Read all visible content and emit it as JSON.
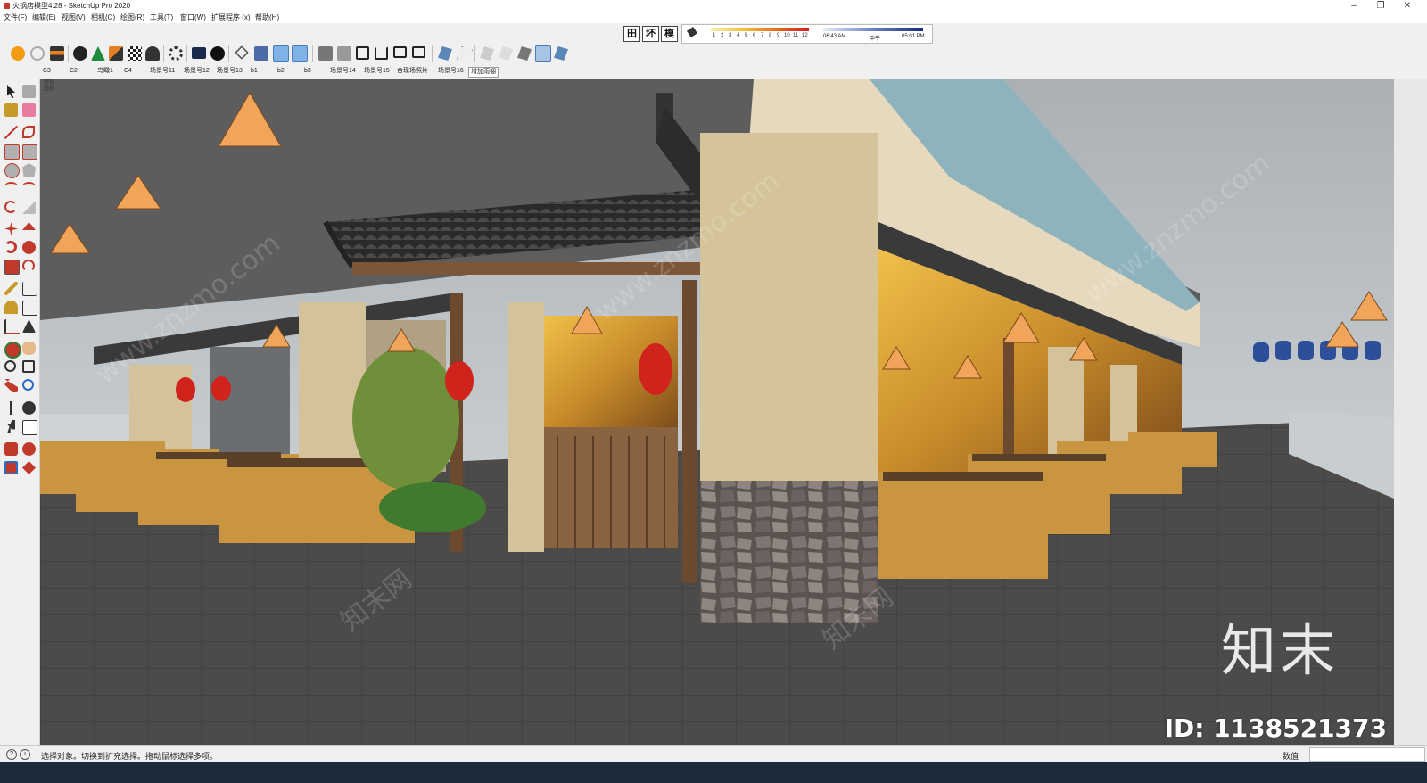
{
  "window": {
    "title": "火锅店模型4.28 - SketchUp Pro 2020",
    "minimize": "–",
    "maximize": "❐",
    "close": "✕"
  },
  "menu": [
    "文件(F)",
    "编辑(E)",
    "视图(V)",
    "相机(C)",
    "绘图(R)",
    "工具(T)",
    "窗口(W)",
    "扩展程序 (x)",
    "帮助(H)"
  ],
  "view_buttons": [
    "田",
    "坏",
    "模"
  ],
  "shadow": {
    "scale": [
      "1",
      "2",
      "3",
      "4",
      "5",
      "6",
      "7",
      "8",
      "9",
      "10",
      "11",
      "12"
    ],
    "time_start": "06:43 AM",
    "time_mid": "中午",
    "time_end": "05:01 PM"
  },
  "scenes": [
    "C3",
    "C2",
    "鸟瞰1",
    "C4",
    "场景号11",
    "场景号12",
    "场景号13",
    "b1",
    "b2",
    "b3",
    "场景号14",
    "场景号15",
    "合现场照片",
    "场景号16",
    "增加雨棚"
  ],
  "active_scene": "增加雨棚",
  "viewport": {
    "corner_label": [
      "俯视",
      "透视"
    ],
    "watermark_logo": "知末",
    "watermark_id": "ID: 1138521373",
    "watermark_site": "www.znzmo.com",
    "watermark_cn": "知末网"
  },
  "status": {
    "text": "选择对象。切换到扩充选择。拖动鼠标选择多项。",
    "measure_label": "数值",
    "measure_value": ""
  },
  "colors": {
    "sky": "#c9cfd3",
    "floor": "#4e4c4b",
    "ceiling": "#5d5d5d",
    "wall": "#d5c49a",
    "wood": "#7d5637",
    "lantern": "#d0231c",
    "roof_tile": "#2c2c2c"
  },
  "icons": {
    "toolbar": [
      "sketchup-logo-icon",
      "refresh-icon",
      "layers-icon",
      "add-circle-icon",
      "tree-icon",
      "terrain-icon",
      "checker-icon",
      "cloud-icon",
      "gear-icon",
      "mail-icon",
      "info-icon",
      "move-icon",
      "cube-icon",
      "cube-blue-icon",
      "cube-blue2-icon",
      "file-icon",
      "file2-icon",
      "house-icon",
      "house-outline-icon",
      "box-icon",
      "shape-icon",
      "shape2-icon",
      "shape3-icon",
      "shape4-icon",
      "shape5-icon",
      "shape6-icon",
      "shape7-icon"
    ],
    "left": [
      "select-icon",
      "paint-icon",
      "eraser-icon",
      "pencil-icon",
      "freehand-icon",
      "rectangle-icon",
      "rotated-rect-icon",
      "circle-icon",
      "polygon-icon",
      "arc-icon",
      "pie-icon",
      "push-pull-icon",
      "follow-me-icon",
      "move-tool-icon",
      "rotate-icon",
      "scale-icon",
      "offset-icon",
      "tape-icon",
      "dimension-icon",
      "protractor-icon",
      "text-icon",
      "axes-icon",
      "3d-text-icon",
      "orbit-icon",
      "pan-icon",
      "zoom-icon",
      "zoom-window-icon",
      "zoom-extents-icon",
      "walk-icon",
      "look-around-icon",
      "position-camera-icon",
      "section-icon",
      "sandbox-icon",
      "sandbox2-icon",
      "sandbox3-icon"
    ]
  }
}
